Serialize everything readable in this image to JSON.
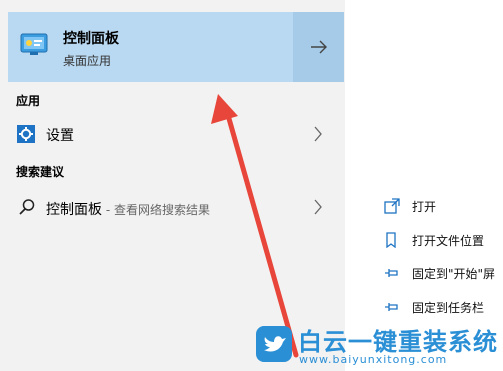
{
  "best_match": {
    "title": "控制面板",
    "subtitle": "桌面应用",
    "icon": "control-panel-icon"
  },
  "sections": {
    "apps": "应用",
    "suggestions": "搜索建议"
  },
  "apps": [
    {
      "label": "设置",
      "icon": "gear-icon"
    }
  ],
  "suggestions": [
    {
      "label": "控制面板",
      "hint": " - 查看网络搜索结果",
      "icon": "search-icon"
    }
  ],
  "actions": [
    {
      "label": "打开",
      "icon": "open-icon"
    },
    {
      "label": "打开文件位置",
      "icon": "file-location-icon"
    },
    {
      "label": "固定到\"开始\"屏",
      "icon": "pin-icon"
    },
    {
      "label": "固定到任务栏",
      "icon": "pin-icon"
    }
  ],
  "watermark": {
    "title": "白云一键重装系统",
    "url": "www.baiyunxitong.com",
    "logo": "twitter-bird-icon"
  },
  "colors": {
    "highlight": "#b9d8f1",
    "arrow": "#e8463a",
    "brand": "#2b8fd6"
  }
}
